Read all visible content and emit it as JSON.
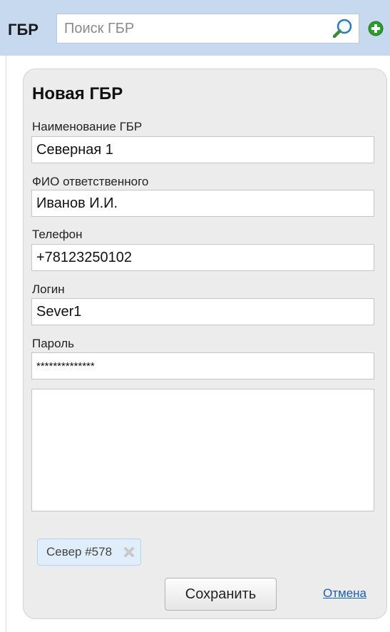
{
  "header": {
    "title": "ГБР",
    "search_placeholder": "Поиск ГБР",
    "search_icon": "magnifier-icon",
    "add_icon": "plus-circle-icon"
  },
  "form": {
    "title": "Новая ГБР",
    "fields": [
      {
        "label": "Наименование ГБР",
        "value": "Северная 1"
      },
      {
        "label": "ФИО ответственного",
        "value": "Иванов И.И."
      },
      {
        "label": "Телефон",
        "value": "+78123250102"
      },
      {
        "label": "Логин",
        "value": "Sever1"
      },
      {
        "label": "Пароль",
        "value": "**************"
      }
    ],
    "notes_value": "",
    "tags": [
      {
        "label": "Север #578"
      }
    ],
    "save_label": "Сохранить",
    "cancel_label": "Отмена"
  },
  "colors": {
    "header_bg": "#c7d9ee",
    "panel_bg": "#ececec",
    "tag_bg": "#dfeefa",
    "link": "#1a5fb4",
    "add_green": "#2a9d2a"
  }
}
